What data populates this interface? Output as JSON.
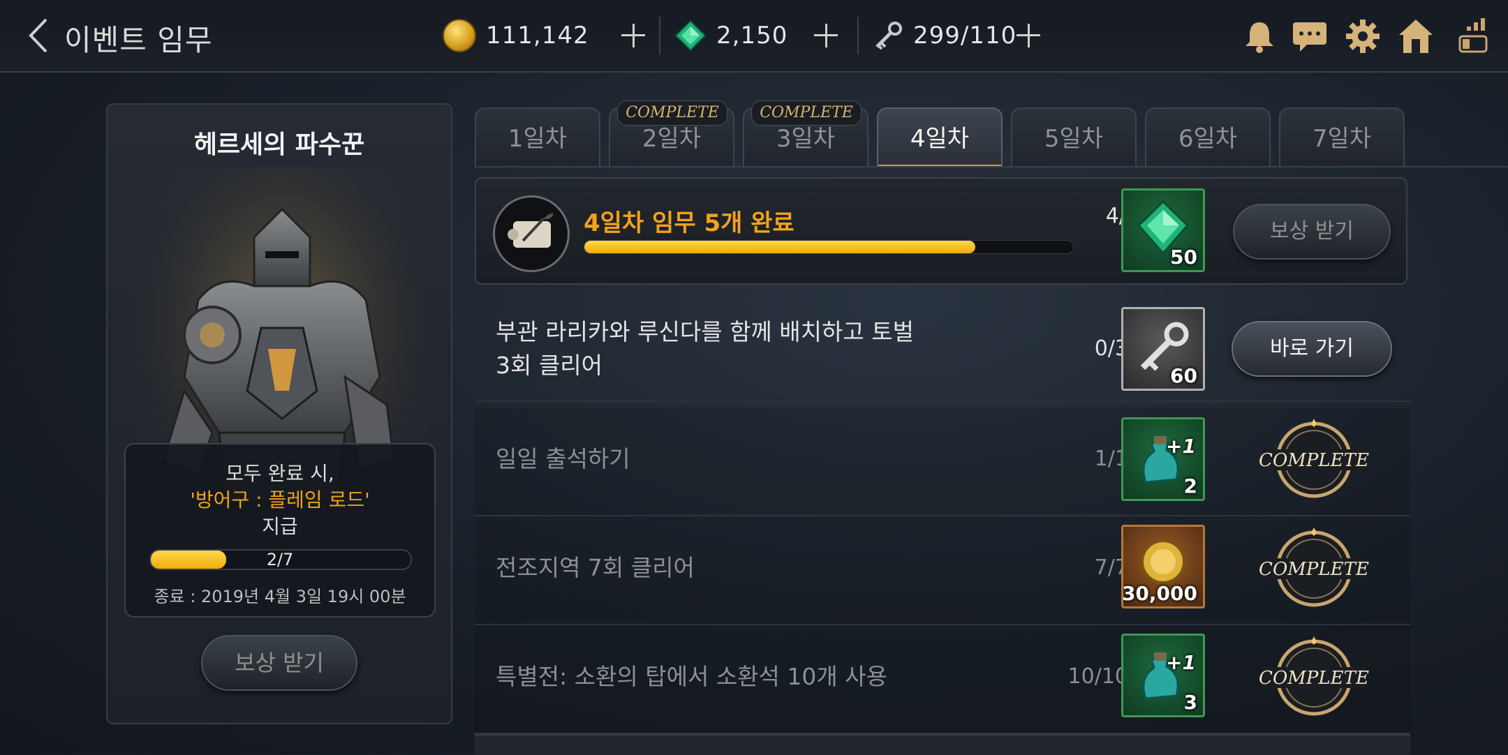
{
  "header": {
    "title": "이벤트 임무",
    "gold": "111,142",
    "gems": "2,150",
    "keys": "299/110"
  },
  "left_panel": {
    "title": "헤르세의 파수꾼",
    "reward_line1": "모두 완료 시,",
    "reward_item": "'방어구 : 플레임 로드'",
    "reward_line3": "지급",
    "progress_text": "2/7",
    "progress_fraction": 0.29,
    "end_text": "종료 : 2019년 4월 3일 19시 00분",
    "button_label": "보상 받기"
  },
  "tabs": [
    {
      "label": "1일차",
      "badge": ""
    },
    {
      "label": "2일차",
      "badge": "COMPLETE"
    },
    {
      "label": "3일차",
      "badge": "COMPLETE"
    },
    {
      "label": "4일차",
      "badge": ""
    },
    {
      "label": "5일차",
      "badge": ""
    },
    {
      "label": "6일차",
      "badge": ""
    },
    {
      "label": "7일차",
      "badge": ""
    }
  ],
  "summary": {
    "title": "4일차 임무 5개 완료",
    "progress": "4/5",
    "progress_fraction": 0.8,
    "reward_qty": "50",
    "button_label": "보상 받기"
  },
  "missions": [
    {
      "text_line1": "부관 라리카와 루신다를 함께 배치하고 토벌",
      "text_line2": "3회 클리어",
      "progress": "0/3",
      "reward_qty": "60",
      "action": "바로 가기"
    },
    {
      "text": "일일 출석하기",
      "progress": "1/1",
      "reward_qty": "2",
      "reward_plus": "+1",
      "status": "COMPLETE"
    },
    {
      "text": "전조지역 7회 클리어",
      "progress": "7/7",
      "reward_qty": "30,000",
      "status": "COMPLETE"
    },
    {
      "text": "특별전: 소환의 탑에서 소환석 10개 사용",
      "progress": "10/10",
      "reward_qty": "3",
      "reward_plus": "+1",
      "status": "COMPLETE"
    }
  ],
  "colors": {
    "accent_orange": "#f3a21c",
    "progress_yellow": "#f0ad0c",
    "complete_gold": "#d7b36e"
  }
}
